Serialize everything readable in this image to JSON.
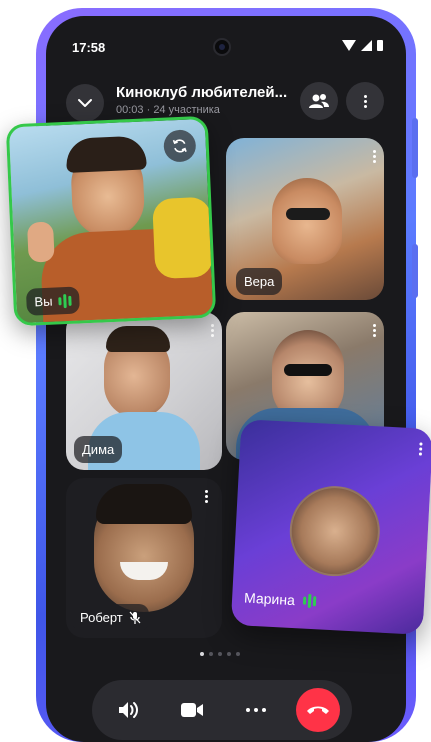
{
  "status_bar": {
    "time": "17:58"
  },
  "header": {
    "title": "Киноклуб любителей...",
    "duration": "00:03",
    "participants": "24 участника"
  },
  "participants": [
    {
      "name": "Вы",
      "speaking": true
    },
    {
      "name": "Вера"
    },
    {
      "name": "Дима"
    },
    {
      "name": "Роберт",
      "mic_muted": true
    },
    {
      "name": "Марина",
      "speaking": true
    }
  ],
  "pager": {
    "pages": 5,
    "current": 1
  },
  "colors": {
    "speaking_border": "#35c84a",
    "end_call": "#ff3347",
    "active_card": "#6a3fd6"
  },
  "icons": [
    "chevron-down-icon",
    "participants-icon",
    "more-vertical-icon",
    "switch-camera-icon",
    "speaker-icon",
    "video-camera-icon",
    "more-horizontal-icon",
    "end-call-icon",
    "mic-off-icon",
    "speaking-indicator-icon"
  ]
}
